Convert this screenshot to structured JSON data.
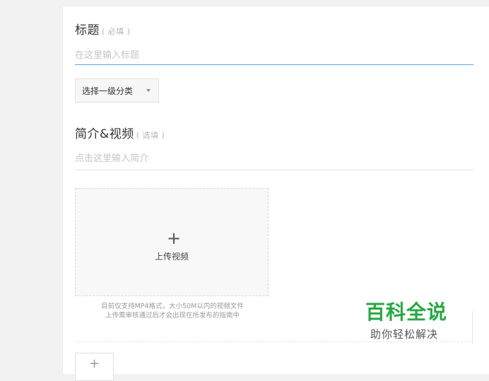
{
  "title_field": {
    "label": "标题",
    "hint": "( 必填 )",
    "placeholder": "在这里输入标题"
  },
  "category_select": {
    "selected": "选择一级分类"
  },
  "intro_field": {
    "label": "简介&视频",
    "hint": "( 选填 )",
    "placeholder": "点击这里输入简介"
  },
  "video_upload": {
    "plus": "+",
    "label": "上传视频",
    "note_line1": "目前仅支持MP4格式，大小50M以内的视频文件",
    "note_line2": "上传需审核通过后才会出现在所发布的指南中"
  },
  "add_step": {
    "plus": "+"
  },
  "watermark": {
    "main": "百科全说",
    "sub": "助你轻松解决"
  },
  "colors": {
    "accent_underline": "#5aa6dc",
    "watermark_green": "#27a743"
  }
}
